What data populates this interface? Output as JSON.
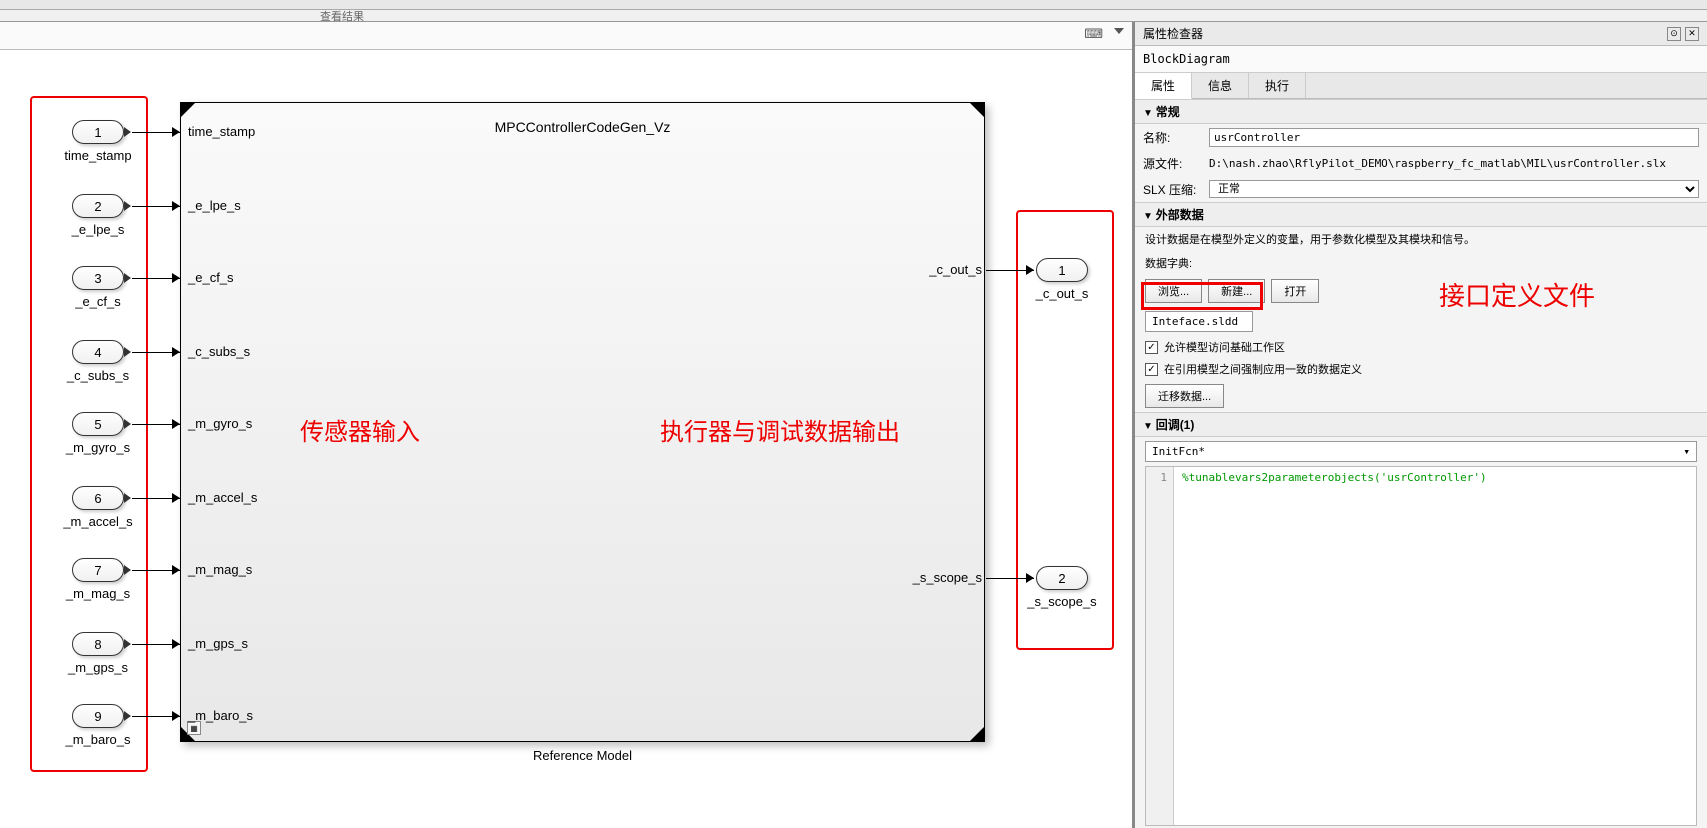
{
  "tab": {
    "label": "查看结果"
  },
  "block": {
    "title": "MPCControllerCodeGen_Vz",
    "caption": "Reference Model"
  },
  "inputs": [
    {
      "num": "1",
      "name": "time_stamp",
      "sig": "time_stamp"
    },
    {
      "num": "2",
      "name": "_e_lpe_s",
      "sig": "_e_lpe_s"
    },
    {
      "num": "3",
      "name": "_e_cf_s",
      "sig": "_e_cf_s"
    },
    {
      "num": "4",
      "name": "_c_subs_s",
      "sig": "_c_subs_s"
    },
    {
      "num": "5",
      "name": "_m_gyro_s",
      "sig": "_m_gyro_s"
    },
    {
      "num": "6",
      "name": "_m_accel_s",
      "sig": "_m_accel_s"
    },
    {
      "num": "7",
      "name": "_m_mag_s",
      "sig": "_m_mag_s"
    },
    {
      "num": "8",
      "name": "_m_gps_s",
      "sig": "_m_gps_s"
    },
    {
      "num": "9",
      "name": "_m_baro_s",
      "sig": "_m_baro_s"
    }
  ],
  "outputs": [
    {
      "num": "1",
      "name": "_c_out_s",
      "sig": "_c_out_s"
    },
    {
      "num": "2",
      "name": "_s_scope_s",
      "sig": "_s_scope_s"
    }
  ],
  "annotations": {
    "sensor": "传感器输入",
    "actuator": "执行器与调试数据输出",
    "interface_file": "接口定义文件"
  },
  "inspector": {
    "title": "属性检查器",
    "type": "BlockDiagram",
    "tabs": {
      "prop": "属性",
      "info": "信息",
      "exec": "执行"
    },
    "general": {
      "head": "常规",
      "name_label": "名称:",
      "name_value": "usrController",
      "source_label": "源文件:",
      "source_value": "D:\\nash.zhao\\RflyPilot_DEMO\\raspberry_fc_matlab\\MIL\\usrController.slx",
      "slx_label": "SLX 压缩:",
      "slx_value": "正常"
    },
    "external": {
      "head": "外部数据",
      "desc": "设计数据是在模型外定义的变量，用于参数化模型及其模块和信号。",
      "dict_label": "数据字典:",
      "browse": "浏览...",
      "new": "新建...",
      "open": "打开",
      "dict_value": "Inteface.sldd",
      "chk1": "允许模型访问基础工作区",
      "chk2": "在引用模型之间强制应用一致的数据定义",
      "migrate": "迁移数据..."
    },
    "callback": {
      "head": "回调(1)",
      "select": "InitFcn*",
      "line_no": "1",
      "code": "%tunablevars2parameterobjects('usrController')"
    }
  }
}
